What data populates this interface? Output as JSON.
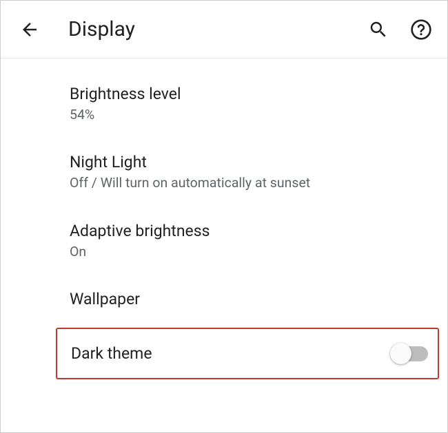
{
  "header": {
    "title": "Display"
  },
  "settings": {
    "brightness": {
      "title": "Brightness level",
      "subtitle": "54%"
    },
    "nightlight": {
      "title": "Night Light",
      "subtitle": "Off / Will turn on automatically at sunset"
    },
    "adaptive": {
      "title": "Adaptive brightness",
      "subtitle": "On"
    },
    "wallpaper": {
      "title": "Wallpaper"
    },
    "darktheme": {
      "title": "Dark theme",
      "enabled": false
    }
  }
}
